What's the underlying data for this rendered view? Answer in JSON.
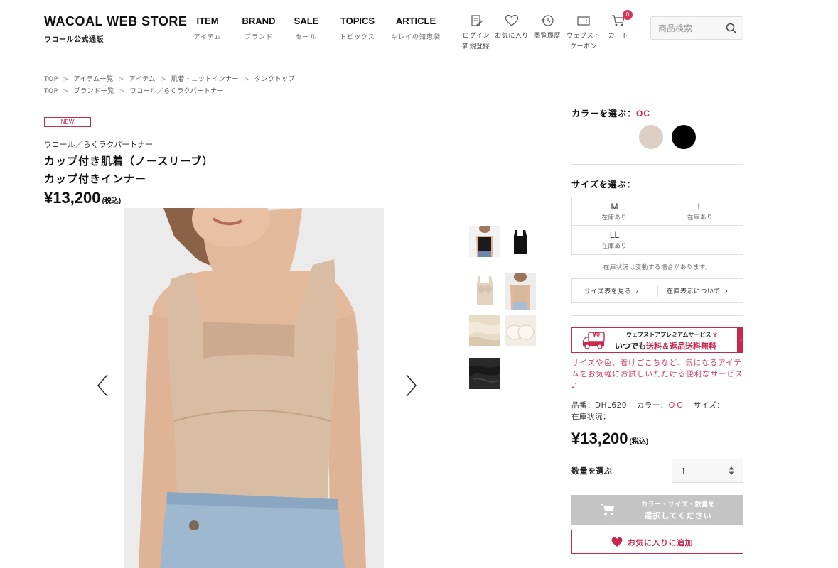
{
  "header": {
    "logo_main": "WACOAL WEB STORE",
    "logo_sub": "ワコール公式通販",
    "nav": [
      {
        "en": "ITEM",
        "jp": "アイテム"
      },
      {
        "en": "BRAND",
        "jp": "ブランド"
      },
      {
        "en": "SALE",
        "jp": "セール"
      },
      {
        "en": "TOPICS",
        "jp": "トピックス"
      },
      {
        "en": "ARTICLE",
        "jp": "キレイの知恵袋"
      }
    ],
    "icons": {
      "login_l1": "ログイン",
      "login_l2": "新規登録",
      "favorite": "お気に入り",
      "history": "閲覧履歴",
      "coupon_l1": "ウェブスト",
      "coupon_l2": "クーポン",
      "cart": "カート",
      "cart_count": "0"
    },
    "search_placeholder": "商品検索"
  },
  "breadcrumbs": {
    "row1": [
      "TOP",
      "アイテム一覧",
      "アイテム",
      "肌着・ニットインナー",
      "タンクトップ"
    ],
    "row2": [
      "TOP",
      "ブランド一覧",
      "ワコール／らくラクパートナー"
    ]
  },
  "product": {
    "badge": "NEW",
    "brand": "ワコール／らくラクパートナー",
    "name_line1": "カップ付き肌着（ノースリーブ）",
    "name_line2": "カップ付きインナー",
    "price": "¥13,200",
    "tax": "(税込)"
  },
  "colors": {
    "title": "カラーを選ぶ：",
    "selected": "OC",
    "swatches": [
      "#dccfc3",
      "#000000"
    ]
  },
  "sizes": {
    "title": "サイズを選ぶ：",
    "items": [
      {
        "size": "M",
        "stock": "在庫あり"
      },
      {
        "size": "L",
        "stock": "在庫あり"
      },
      {
        "size": "LL",
        "stock": "在庫あり"
      }
    ],
    "note": "在庫状況は変動する場合があります。",
    "size_chart_link": "サイズ表を見る",
    "stock_info_link": "在庫表示について"
  },
  "premium": {
    "badge_price": "¥0",
    "line1": "ウェブストアプレミアムサービス",
    "line2_prefix": "いつでも",
    "line2_highlight": "送料＆返品送料無料",
    "description": "サイズや色、着けごこちなど、気になるアイテムをお気軽にお試しいただける便利なサービス♪"
  },
  "spec": {
    "code_label": "品番：",
    "code": "DHL620",
    "color_label": "カラー：",
    "color": "ＯＣ",
    "size_label": "サイズ：",
    "stock_label": "在庫状況：",
    "price": "¥13,200",
    "tax": "(税込)"
  },
  "quantity": {
    "label": "数量を選ぶ",
    "value": "1"
  },
  "cart_button": {
    "line1": "カラー・サイズ・数量を",
    "line2": "選択してください"
  },
  "favorite_button": "お気に入りに追加",
  "accent_color": "#c8284c"
}
